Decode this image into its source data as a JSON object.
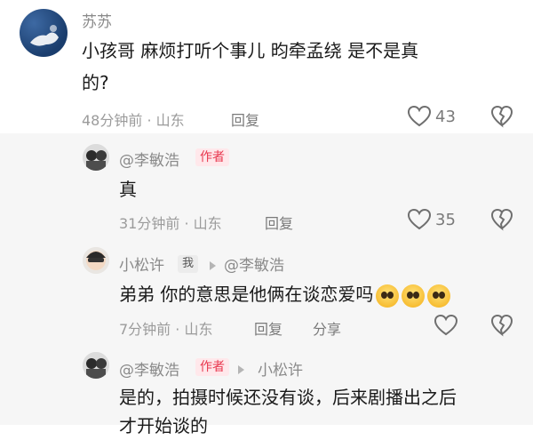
{
  "comments": [
    {
      "user": "苏苏",
      "text_line1": "小孩哥  麻烦打听个事儿    昀牵孟绕   是不是真",
      "text_line2": "的?",
      "time_loc": "48分钟前 · 山东",
      "reply_label": "回复",
      "likes": "43"
    }
  ],
  "replies": [
    {
      "user": "@李敏浩",
      "badge": "作者",
      "text": "真",
      "time_loc": "31分钟前 · 山东",
      "reply_label": "回复",
      "likes": "35"
    },
    {
      "user": "小松许",
      "badge": "我",
      "reply_to": "@李敏浩",
      "text": "弟弟 你的意思是他俩在谈恋爱吗",
      "time_loc": "7分钟前 · 山东",
      "reply_label": "回复",
      "share_label": "分享"
    },
    {
      "user": "@李敏浩",
      "badge": "作者",
      "reply_to": "小松许",
      "text_line1": "是的，拍摄时候还没有谈，后来剧播出之后",
      "text_line2": "才开始谈的"
    }
  ],
  "colors": {
    "author_badge": "#e8384f",
    "reply_bg": "#f6f6f6"
  }
}
